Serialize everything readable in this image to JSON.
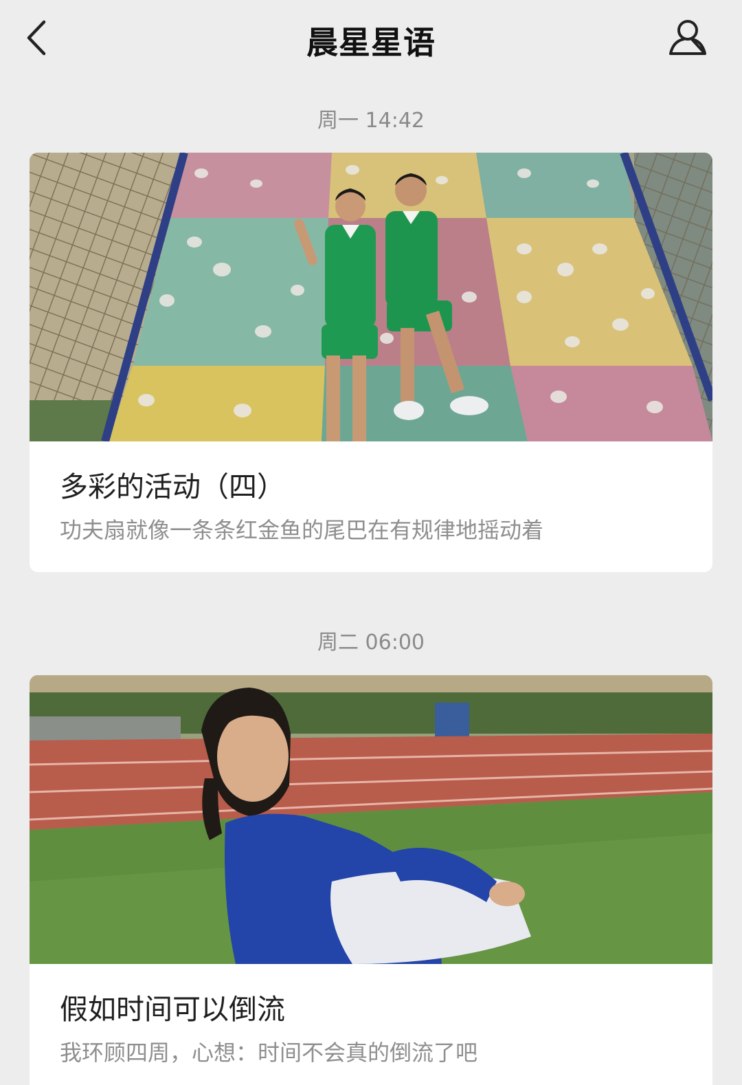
{
  "header": {
    "title": "晨星星语",
    "back_icon": "chevron-left-icon",
    "profile_icon": "user-icon"
  },
  "feed": [
    {
      "time": "周一 14:42",
      "title": "多彩的活动（四）",
      "digest": "功夫扇就像一条条红金鱼的尾巴在有规律地摇动着"
    },
    {
      "time": "周二 06:00",
      "title": "假如时间可以倒流",
      "digest": "我环顾四周，心想：时间不会真的倒流了吧"
    }
  ],
  "colors": {
    "background": "#ededed",
    "card": "#ffffff",
    "timestamp": "#8a8a8a",
    "digest": "#8e8e8e"
  }
}
